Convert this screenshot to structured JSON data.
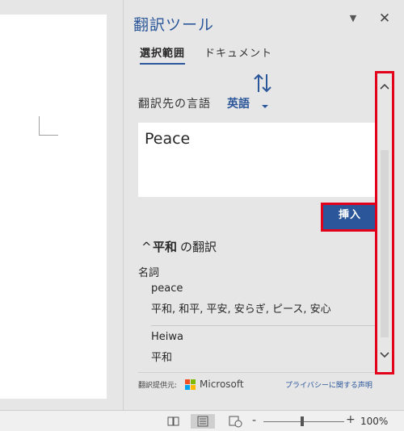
{
  "pane": {
    "title": "翻訳ツール",
    "options_glyph": "▼",
    "close_glyph": "✕",
    "tabs": [
      {
        "label": "選択範囲",
        "selected": true
      },
      {
        "label": "ドキュメント",
        "selected": false
      }
    ],
    "target_language_label": "翻訳先の言語",
    "target_language_value": "英語",
    "translation_text": "Peace",
    "insert_label": "挿入",
    "section": {
      "caret": "^",
      "source_word": "平和",
      "suffix": "の翻訳"
    },
    "part_of_speech": "名詞",
    "entries": [
      {
        "word": "peace",
        "translations": "平和, 和平, 平安, 安らぎ, ピース, 安心"
      },
      {
        "word": "Heiwa",
        "translations": "平和"
      }
    ],
    "footer": {
      "provider_label": "翻訳提供元:",
      "provider_name": "Microsoft",
      "privacy_link": "プライバシーに関する声明"
    },
    "colors": {
      "accent": "#2b579a",
      "highlight": "#e3001b",
      "ms_red": "#f25022",
      "ms_green": "#7fba00",
      "ms_blue": "#00a4ef",
      "ms_yellow": "#ffb900"
    },
    "icons": [
      "swap-icon",
      "chevron-down-icon",
      "scroll-up-icon",
      "scroll-down-icon",
      "microsoft-logo-icon"
    ]
  },
  "statusbar": {
    "zoom_minus": "-",
    "zoom_plus": "+",
    "zoom_level": "100%"
  }
}
